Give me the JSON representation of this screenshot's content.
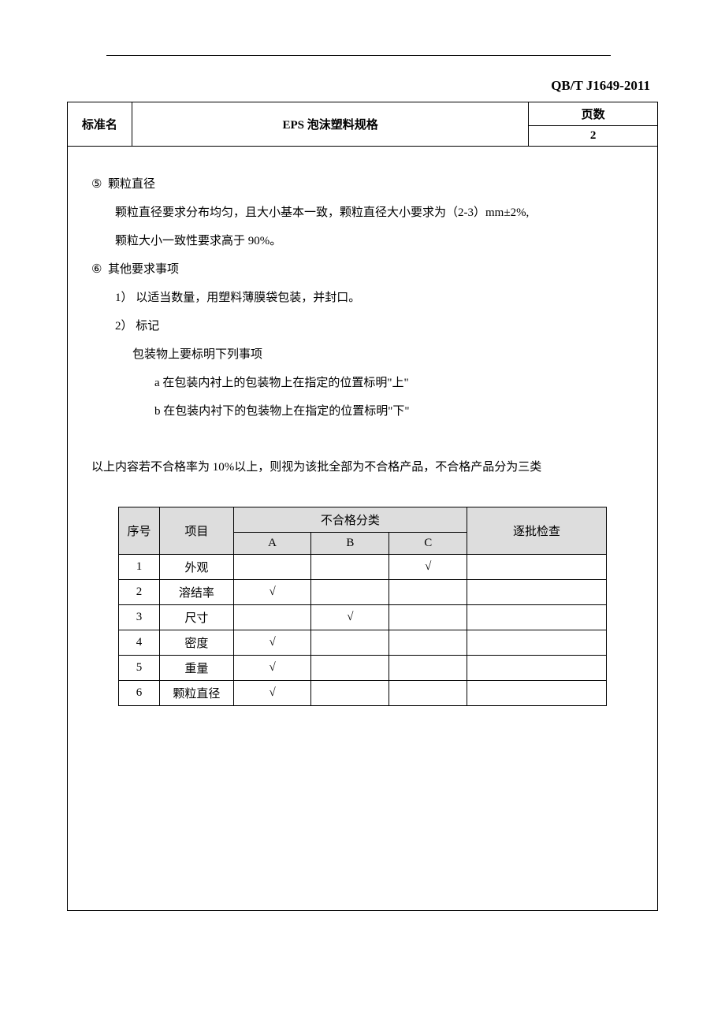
{
  "doc_code": "QB/T J1649-2011",
  "header": {
    "std_name_label": "标准名",
    "title": "EPS 泡沫塑料规格",
    "page_label": "页数",
    "page_number": "2"
  },
  "body": {
    "item5_num": "⑤",
    "item5_title": "颗粒直径",
    "item5_line1": "颗粒直径要求分布均匀，且大小基本一致，颗粒直径大小要求为（2-3）mm±2%,",
    "item5_line2": "颗粒大小一致性要求高于 90%。",
    "item6_num": "⑥",
    "item6_title": "其他要求事项",
    "item6_sub1": "1） 以适当数量，用塑料薄膜袋包装，并封口。",
    "item6_sub2": "2） 标记",
    "item6_sub2_1": "包装物上要标明下列事项",
    "item6_sub2_a": "a  在包装内衬上的包装物上在指定的位置标明\"上\"",
    "item6_sub2_b": "b  在包装内衬下的包装物上在指定的位置标明\"下\"",
    "bottom_note": "以上内容若不合格率为 10%以上，则视为该批全部为不合格产品，不合格产品分为三类"
  },
  "table": {
    "head": {
      "idx": "序号",
      "item": "项目",
      "nc_group": "不合格分类",
      "a": "A",
      "b": "B",
      "c": "C",
      "check": "逐批检查"
    },
    "rows": [
      {
        "idx": "1",
        "item": "外观",
        "a": "",
        "b": "",
        "c": "√",
        "check": ""
      },
      {
        "idx": "2",
        "item": "溶结率",
        "a": "√",
        "b": "",
        "c": "",
        "check": ""
      },
      {
        "idx": "3",
        "item": "尺寸",
        "a": "",
        "b": "√",
        "c": "",
        "check": ""
      },
      {
        "idx": "4",
        "item": "密度",
        "a": "√",
        "b": "",
        "c": "",
        "check": ""
      },
      {
        "idx": "5",
        "item": "重量",
        "a": "√",
        "b": "",
        "c": "",
        "check": ""
      },
      {
        "idx": "6",
        "item": "颗粒直径",
        "a": "√",
        "b": "",
        "c": "",
        "check": ""
      }
    ]
  }
}
